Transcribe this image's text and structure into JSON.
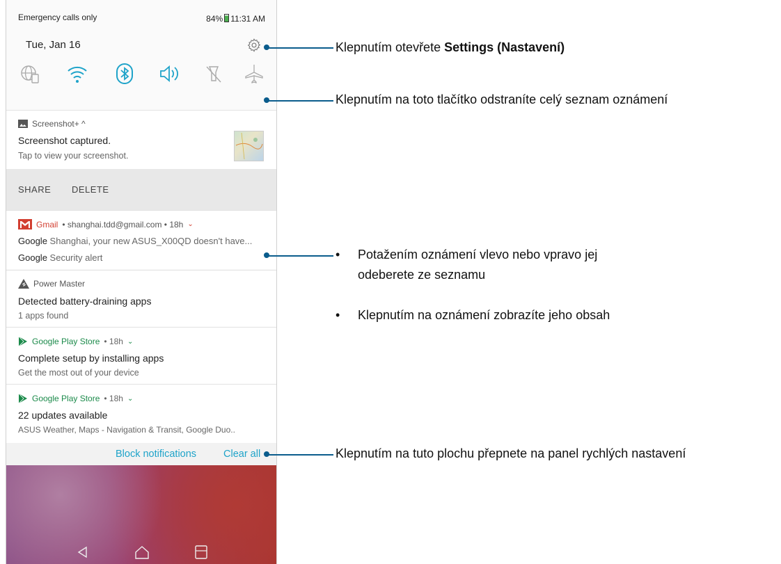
{
  "status_bar": {
    "carrier": "Emergency calls only",
    "battery": "84%",
    "time": "11:31 AM"
  },
  "quick_settings": {
    "date": "Tue, Jan 16",
    "icons": [
      "sim-icon",
      "wifi-icon",
      "bluetooth-icon",
      "volume-icon",
      "flashlight-off-icon",
      "airplane-mode-icon"
    ]
  },
  "notifications": {
    "screenshot": {
      "app": "Screenshot+ ^",
      "title": "Screenshot captured.",
      "body": "Tap to view your screenshot.",
      "actions": [
        "SHARE",
        "DELETE"
      ]
    },
    "gmail": {
      "app": "Gmail",
      "meta": "• shanghai.tdd@gmail.com • 18h",
      "line1_sender": "Google",
      "line1_text": "Shanghai, your new ASUS_X00QD doesn't have...",
      "line2_sender": "Google",
      "line2_text": "Security alert"
    },
    "power_master": {
      "app": "Power Master",
      "title": "Detected battery-draining apps",
      "body": "1 apps found"
    },
    "play1": {
      "app": "Google Play Store",
      "meta": "• 18h",
      "title": "Complete setup by installing apps",
      "body": "Get the most out of your device"
    },
    "play2": {
      "app": "Google Play Store",
      "meta": "• 18h",
      "title": "22 updates available",
      "body": "ASUS Weather, Maps - Navigation & Transit, Google Duo.."
    }
  },
  "footer": {
    "block": "Block notifications",
    "clear": "Clear all"
  },
  "callouts": {
    "settings_pre": "Klepnutím otevřete ",
    "settings_bold": "Settings (Nastavení)",
    "clear_list": "Klepnutím na toto tlačítko odstraníte celý seznam oznámení",
    "swipe": "Potažením oznámení vlevo nebo vpravo jej odeberete ze seznamu",
    "tap": "Klepnutím na oznámení zobrazíte jeho obsah",
    "quick_panel": "Klepnutím na tuto plochu přepnete na panel rychlých nastavení",
    "bullet": "•"
  },
  "colors": {
    "callout_line": "#0a5c8c",
    "link": "#1ea3c9",
    "gmail_red": "#d23f31",
    "play_green": "#1b8a4a"
  }
}
